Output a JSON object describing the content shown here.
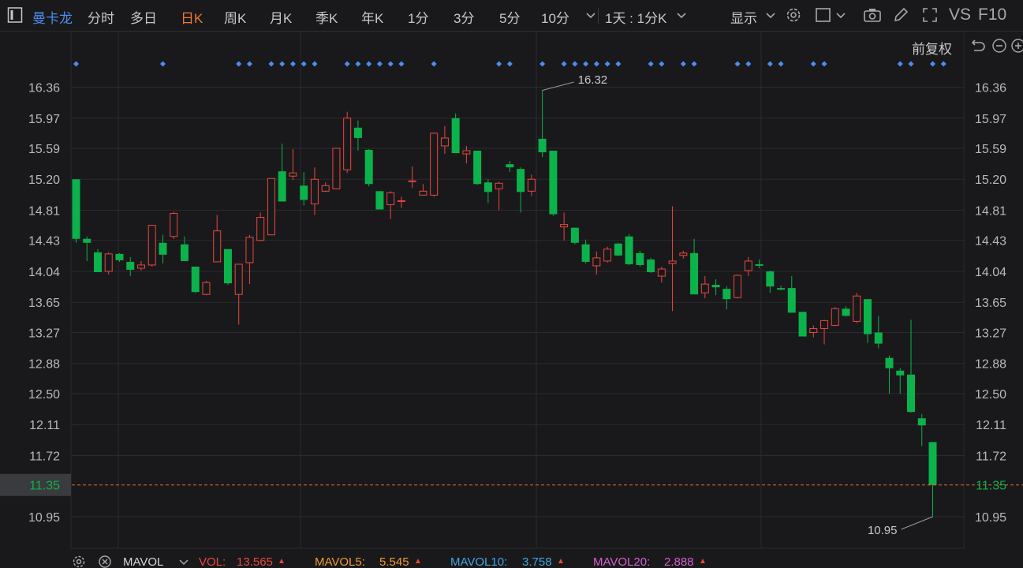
{
  "toolbar": {
    "stock_name": "曼卡龙",
    "periods": [
      "分时",
      "多日",
      "日K",
      "周K",
      "月K",
      "季K",
      "年K",
      "1分",
      "3分",
      "5分",
      "10分"
    ],
    "active_period": "日K",
    "interval": "1天 : 1分K",
    "display_label": "显示",
    "vs_label": "VS",
    "f10_label": "F10",
    "adjust_label": "前复权"
  },
  "colors": {
    "up": "#e8473f",
    "down": "#0cb24b",
    "marker": "#4b8df0",
    "price_line": "#e56b2c",
    "grid": "#2b2b2e"
  },
  "icons": [
    "collapse-icon",
    "chevron-down-icon",
    "settings-icon",
    "checkbox-icon",
    "camera-icon",
    "pencil-icon",
    "fullscreen-icon",
    "undo-icon",
    "zoom-out-icon",
    "zoom-in-icon"
  ],
  "chart_data": {
    "type": "candlestick",
    "y_ticks": [
      16.36,
      15.97,
      15.59,
      15.2,
      14.81,
      14.43,
      14.04,
      13.65,
      13.27,
      12.88,
      12.5,
      12.11,
      11.72,
      10.95
    ],
    "ylim": [
      10.75,
      16.6
    ],
    "current_price": "11.35",
    "max_label": "16.32",
    "min_label": "10.95",
    "candles": [
      [
        15.2,
        14.45,
        15.2,
        14.4
      ],
      [
        14.45,
        14.4,
        14.48,
        14.17
      ],
      [
        14.28,
        14.03,
        14.32,
        14.03
      ],
      [
        14.04,
        14.26,
        14.28,
        14.0
      ],
      [
        14.26,
        14.18,
        14.27,
        14.16
      ],
      [
        14.16,
        14.06,
        14.22,
        13.98
      ],
      [
        14.08,
        14.12,
        14.17,
        14.05
      ],
      [
        14.12,
        14.62,
        14.62,
        14.1
      ],
      [
        14.4,
        14.25,
        14.5,
        14.14
      ],
      [
        14.48,
        14.77,
        14.79,
        14.45
      ],
      [
        14.38,
        14.17,
        14.48,
        14.17
      ],
      [
        14.1,
        13.78,
        14.1,
        13.77
      ],
      [
        13.75,
        13.9,
        13.92,
        13.74
      ],
      [
        14.16,
        14.55,
        14.75,
        14.16
      ],
      [
        14.32,
        13.89,
        14.32,
        13.87
      ],
      [
        13.75,
        14.13,
        14.13,
        13.37
      ],
      [
        14.15,
        14.47,
        14.5,
        13.88
      ],
      [
        14.43,
        14.72,
        14.78,
        14.42
      ],
      [
        14.5,
        15.21,
        15.21,
        14.5
      ],
      [
        15.3,
        14.92,
        15.65,
        14.92
      ],
      [
        15.24,
        15.28,
        15.58,
        15.19
      ],
      [
        15.12,
        14.94,
        15.29,
        14.87
      ],
      [
        14.89,
        15.2,
        15.35,
        14.75
      ],
      [
        15.05,
        15.12,
        15.16,
        15.04
      ],
      [
        15.08,
        15.59,
        15.59,
        15.08
      ],
      [
        15.32,
        15.97,
        16.05,
        15.28
      ],
      [
        15.85,
        15.72,
        15.94,
        15.56
      ],
      [
        15.57,
        15.14,
        15.58,
        15.11
      ],
      [
        15.05,
        14.82,
        15.05,
        14.82
      ],
      [
        14.88,
        15.03,
        15.05,
        14.7
      ],
      [
        14.93,
        14.93,
        14.98,
        14.84
      ],
      [
        15.18,
        15.18,
        15.36,
        15.09
      ],
      [
        15.0,
        15.05,
        15.14,
        15.0
      ],
      [
        15.0,
        15.78,
        15.79,
        14.98
      ],
      [
        15.62,
        15.72,
        15.87,
        15.52
      ],
      [
        15.97,
        15.53,
        16.03,
        15.53
      ],
      [
        15.52,
        15.56,
        15.62,
        15.4
      ],
      [
        15.56,
        15.14,
        15.56,
        15.13
      ],
      [
        15.16,
        15.04,
        15.2,
        14.9
      ],
      [
        15.08,
        15.15,
        15.17,
        14.81
      ],
      [
        15.39,
        15.35,
        15.43,
        15.29
      ],
      [
        15.33,
        15.04,
        15.35,
        14.78
      ],
      [
        15.05,
        15.2,
        15.26,
        14.99
      ],
      [
        15.71,
        15.54,
        16.32,
        15.48
      ],
      [
        15.56,
        14.76,
        15.56,
        14.74
      ],
      [
        14.6,
        14.63,
        14.78,
        14.43
      ],
      [
        14.59,
        14.4,
        14.59,
        14.38
      ],
      [
        14.38,
        14.16,
        14.44,
        14.14
      ],
      [
        14.11,
        14.21,
        14.29,
        14.0
      ],
      [
        14.17,
        14.32,
        14.35,
        14.15
      ],
      [
        14.39,
        14.24,
        14.4,
        14.23
      ],
      [
        14.48,
        14.13,
        14.51,
        14.12
      ],
      [
        14.27,
        14.12,
        14.3,
        14.1
      ],
      [
        14.19,
        14.03,
        14.21,
        14.02
      ],
      [
        13.98,
        14.07,
        14.1,
        13.9
      ],
      [
        14.14,
        14.17,
        14.86,
        13.54
      ],
      [
        14.24,
        14.27,
        14.3,
        14.2
      ],
      [
        14.27,
        13.75,
        14.45,
        13.75
      ],
      [
        13.77,
        13.88,
        13.98,
        13.7
      ],
      [
        13.87,
        13.84,
        13.94,
        13.74
      ],
      [
        13.82,
        13.69,
        13.85,
        13.56
      ],
      [
        13.71,
        13.99,
        14.0,
        13.7
      ],
      [
        14.05,
        14.17,
        14.22,
        13.98
      ],
      [
        14.13,
        14.11,
        14.19,
        14.08
      ],
      [
        14.04,
        13.85,
        14.05,
        13.77
      ],
      [
        13.83,
        13.81,
        13.86,
        13.8
      ],
      [
        13.83,
        13.52,
        13.98,
        13.52
      ],
      [
        13.53,
        13.22,
        13.53,
        13.22
      ],
      [
        13.27,
        13.32,
        13.36,
        13.21
      ],
      [
        13.32,
        13.42,
        13.43,
        13.12
      ],
      [
        13.36,
        13.57,
        13.59,
        13.35
      ],
      [
        13.57,
        13.48,
        13.6,
        13.47
      ],
      [
        13.41,
        13.73,
        13.77,
        13.39
      ],
      [
        13.69,
        13.25,
        13.69,
        13.14
      ],
      [
        13.27,
        13.13,
        13.48,
        13.07
      ],
      [
        12.95,
        12.82,
        12.98,
        12.5
      ],
      [
        12.79,
        12.73,
        12.82,
        12.5
      ],
      [
        12.74,
        12.27,
        13.43,
        12.26
      ],
      [
        12.19,
        12.1,
        12.24,
        11.84
      ],
      [
        11.89,
        11.35,
        11.89,
        10.95
      ]
    ],
    "marker_indices": [
      0,
      8,
      15,
      16,
      18,
      19,
      20,
      21,
      22,
      25,
      26,
      27,
      28,
      29,
      30,
      33,
      39,
      40,
      43,
      45,
      46,
      47,
      48,
      49,
      50,
      53,
      54,
      56,
      57,
      61,
      62,
      64,
      65,
      68,
      69,
      76,
      77,
      79,
      80
    ],
    "indicators": {
      "panel_label": "MAVOL",
      "vol_label": "VOL:",
      "vol_value": "13.565",
      "mavol5_label": "MAVOL5:",
      "mavol5_value": "5.545",
      "mavol10_label": "MAVOL10:",
      "mavol10_value": "3.758",
      "mavol20_label": "MAVOL20:",
      "mavol20_value": "2.888"
    }
  }
}
